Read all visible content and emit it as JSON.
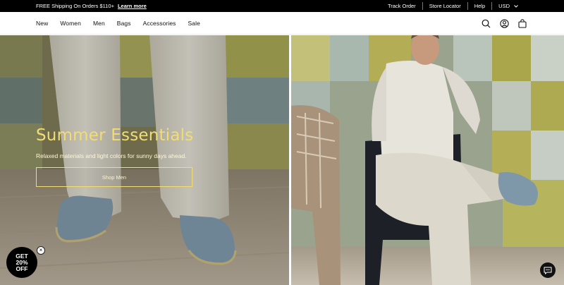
{
  "announcement": {
    "shipping_text": "FREE Shipping On Orders $110+",
    "learn_more": "Learn more",
    "links": [
      "Track Order",
      "Store Locator",
      "Help"
    ],
    "currency": "USD"
  },
  "nav": {
    "items": [
      "New",
      "Women",
      "Men",
      "Bags",
      "Accessories",
      "Sale"
    ]
  },
  "header_icons": [
    "search-icon",
    "account-icon",
    "bag-icon"
  ],
  "hero": {
    "title": "Summer Essentials",
    "subtitle": "Relaxed materials and light colors for sunny days ahead.",
    "button_label": "Shop Men"
  },
  "promo": {
    "line1": "GET",
    "line2": "20%",
    "line3": "OFF",
    "close_glyph": "×"
  },
  "colors": {
    "accent": "#f3dc72",
    "announcement_bg": "#000000"
  }
}
